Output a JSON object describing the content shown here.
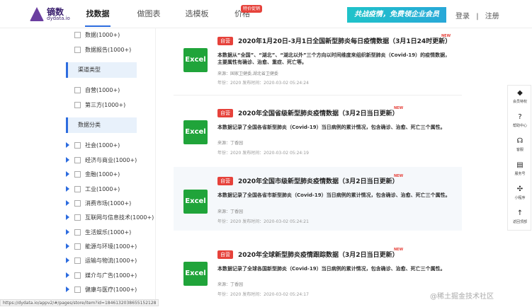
{
  "header": {
    "logo_name": "镝数",
    "logo_sub": "dydata.io",
    "nav": [
      "找数据",
      "做图表",
      "选模板",
      "价格"
    ],
    "price_badge": "特价促销",
    "banner": "共战疫情，免费领企业会员",
    "login": "登录",
    "separator": "|",
    "register": "注册"
  },
  "sidebar": {
    "top_items": [
      "数据(1000+)",
      "数据报告(1000+)"
    ],
    "channel_title": "渠道类型",
    "channel_items": [
      "自营(1000+)",
      "第三方(1000+)"
    ],
    "category_title": "数据分类",
    "category_items": [
      "社会(1000+)",
      "经济与商业(1000+)",
      "金融(1000+)",
      "工业(1000+)",
      "消费市场(1000+)",
      "互联网与信息技术(1000+)",
      "生活娱乐(1000+)",
      "能源与环境(1000+)",
      "运输与物流(1000+)",
      "媒介与广告(1000+)",
      "健康与医疗(1000+)"
    ]
  },
  "cards": [
    {
      "tag": "自营",
      "title": "2020年1月20日-3月1日全国新型肺炎每日疫情数据（3月1日24时更新）",
      "new": "NEW",
      "desc": "本数据从“全国”、“湖北”、“湖北以外”三个方向以时间维度来组织新型肺炎（Covid-19）的疫情数据，主要属性有确诊、治愈、重症、死亡等。",
      "source": "来源：国家卫健委,湖北省卫健委",
      "meta": "年份：2020    发布时间：2020-03-02 05:24:24",
      "excel": "Excel"
    },
    {
      "tag": "自营",
      "title": "2020年全国省级新型肺炎疫情数据（3月2日当日更新）",
      "new": "NEW",
      "desc": "本数据记录了全国各省新型肺炎（Covid-19）当日病例的累计情况，包含确诊、治愈、死亡三个属性。",
      "source": "来源：丁香园",
      "meta": "年份：2020    发布时间：2020-03-02 05:24:19",
      "excel": "Excel"
    },
    {
      "tag": "自营",
      "title": "2020年全国市级新型肺炎疫情数据（3月2日当日更新）",
      "new": "NEW",
      "desc": "本数据记录了全国各省市新型肺炎（Covid-19）当日病例的累计情况，包含确诊、治愈、死亡三个属性。",
      "source": "来源：丁香园",
      "meta": "年份：2020    发布时间：2020-03-02 05:24:21",
      "excel": "Excel"
    },
    {
      "tag": "自营",
      "title": "2020年全球新型肺炎疫情跟踪数据（3月2日当日更新）",
      "new": "NEW",
      "desc": "本数据记录了全球各国新型肺炎（Covid-19）当日病例的累计情况，包含确诊、治愈、死亡三个属性。",
      "source": "来源：丁香园",
      "meta": "年份：2020    发布时间：2020-03-02 05:24:17",
      "excel": "Excel"
    }
  ],
  "float_menu": [
    {
      "icon": "vip-diamond-icon",
      "glyph": "◆",
      "label": "会员特权"
    },
    {
      "icon": "help-icon",
      "glyph": "?",
      "label": "帮助中心"
    },
    {
      "icon": "headset-icon",
      "glyph": "☊",
      "label": "客服"
    },
    {
      "icon": "service-account-icon",
      "glyph": "▤",
      "label": "服务号"
    },
    {
      "icon": "mini-program-icon",
      "glyph": "✣",
      "label": "小程序"
    },
    {
      "icon": "back-to-top-icon",
      "glyph": "↑",
      "label": "返回顶部"
    }
  ],
  "status_url": "https://dydata.io/appv2/#/pages/store/item?id=1846132038655152128",
  "watermark": "@稀土掘金技术社区",
  "colors": {
    "accent": "#2d6cdf",
    "tag_red": "#e6423b",
    "excel_green": "#20a43a",
    "banner": "#1fc3c9"
  }
}
